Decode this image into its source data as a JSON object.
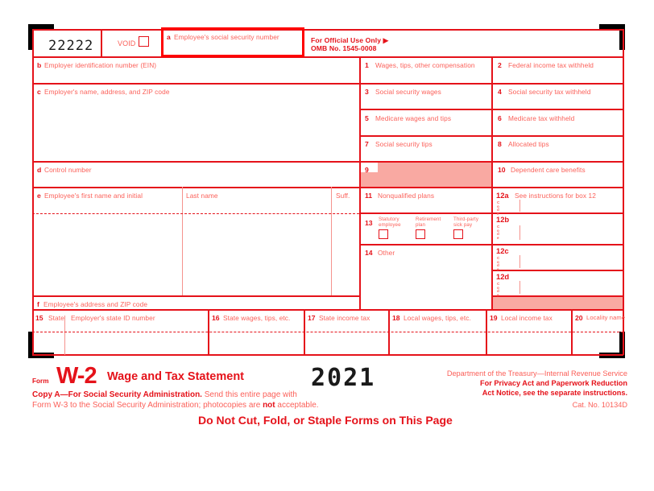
{
  "form": {
    "void_code": "22222",
    "void_label": "VOID",
    "box_a_label": "Employee's social security number",
    "box_a_letter": "a",
    "official_use": "For Official Use Only ▶",
    "omb": "OMB No. 1545-0008",
    "box_b_letter": "b",
    "box_b_label": "Employer identification number (EIN)",
    "box_c_letter": "c",
    "box_c_label": "Employer's name, address, and ZIP code",
    "box_d_letter": "d",
    "box_d_label": "Control number",
    "box_e_letter": "e",
    "box_e_label": "Employee's first name and initial",
    "last_name_label": "Last name",
    "suffix_label": "Suff.",
    "box_f_letter": "f",
    "box_f_label": "Employee's address and ZIP code"
  },
  "numbered_boxes": [
    {
      "num": "1",
      "label": "Wages, tips, other compensation"
    },
    {
      "num": "2",
      "label": "Federal income tax withheld"
    },
    {
      "num": "3",
      "label": "Social security wages"
    },
    {
      "num": "4",
      "label": "Social security tax withheld"
    },
    {
      "num": "5",
      "label": "Medicare wages and tips"
    },
    {
      "num": "6",
      "label": "Medicare tax withheld"
    },
    {
      "num": "7",
      "label": "Social security tips"
    },
    {
      "num": "8",
      "label": "Allocated tips"
    },
    {
      "num": "9",
      "label": ""
    },
    {
      "num": "10",
      "label": "Dependent care benefits"
    },
    {
      "num": "11",
      "label": "Nonqualified plans"
    },
    {
      "num": "13",
      "label": ""
    },
    {
      "num": "14",
      "label": "Other"
    }
  ],
  "box12": {
    "a": {
      "num": "12a",
      "label": "See instructions for box 12",
      "code": "Code"
    },
    "b": {
      "num": "12b",
      "label": "",
      "code": "Code"
    },
    "c": {
      "num": "12c",
      "label": "",
      "code": "Code"
    },
    "d": {
      "num": "12d",
      "label": "",
      "code": "Code"
    }
  },
  "box13": {
    "num": "13",
    "checkboxes": [
      {
        "line1": "Statutory",
        "line2": "employee",
        "checked": false
      },
      {
        "line1": "Retirement",
        "line2": "plan",
        "checked": false
      },
      {
        "line1": "Third-party",
        "line2": "sick pay",
        "checked": false
      }
    ]
  },
  "state_local": [
    {
      "num": "15",
      "label": "State"
    },
    {
      "num": "",
      "label": "Employer's state ID number"
    },
    {
      "num": "16",
      "label": "State wages, tips, etc."
    },
    {
      "num": "17",
      "label": "State income tax"
    },
    {
      "num": "18",
      "label": "Local wages, tips, etc."
    },
    {
      "num": "19",
      "label": "Local income tax"
    },
    {
      "num": "20",
      "label": "Locality name"
    }
  ],
  "footer": {
    "form_word": "Form",
    "form_number": "W-2",
    "form_title": "Wage and Tax Statement",
    "year": "2021",
    "copy_line1_bold": "Copy A—For Social Security Administration.",
    "copy_line1_rest": " Send this entire page with",
    "copy_line2_a": "Form W-3 to the Social Security Administration; photocopies are ",
    "copy_line2_bold": "not",
    "copy_line2_b": " acceptable.",
    "do_not_cut": "Do Not Cut, Fold, or Staple Forms on This Page",
    "treasury": "Department of the Treasury—Internal Revenue Service",
    "privacy_line1": "For Privacy Act and Paperwork Reduction",
    "privacy_line2": "Act Notice, see the separate instructions.",
    "cat_no": "Cat. No. 10134D"
  },
  "colors": {
    "rule_red": "#e5121a",
    "label_red": "#fb5f58",
    "pink_fill": "#f9a9a2",
    "ssn_frame": "#ff0000"
  }
}
